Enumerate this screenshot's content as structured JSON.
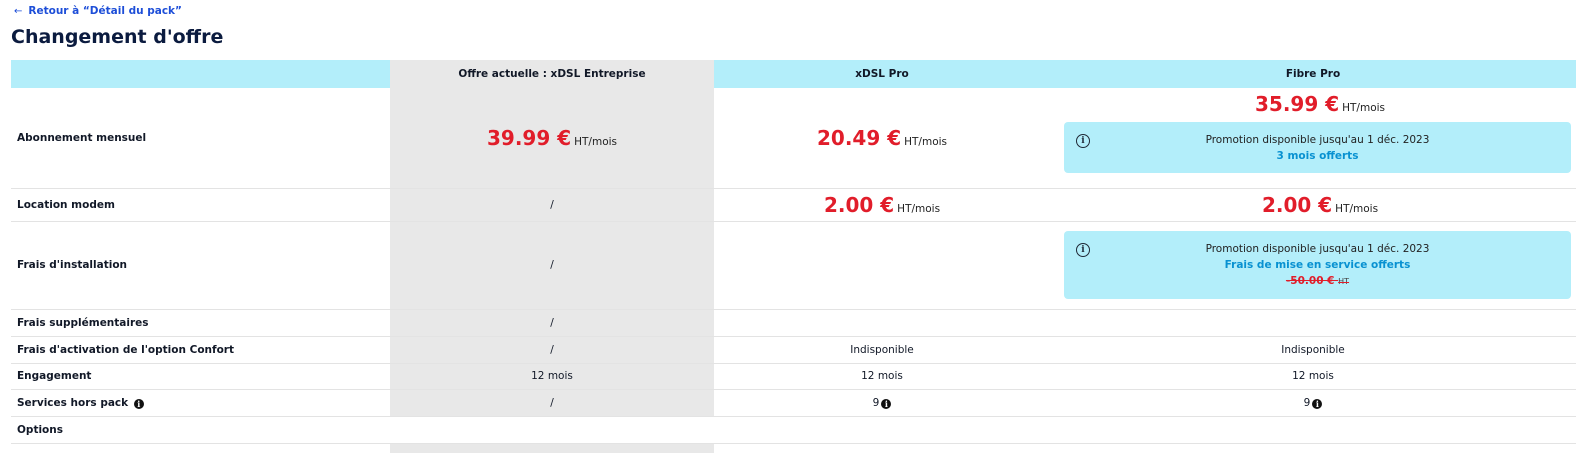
{
  "back_link": {
    "arrow": "←",
    "label": "Retour à “Détail du pack”"
  },
  "page_title": "Changement d'offre",
  "columns": {
    "current": "Offre actuelle : xDSL Entreprise",
    "xdsl": "xDSL Pro",
    "fibre": "Fibre Pro"
  },
  "rows": {
    "abonnement": {
      "label": "Abonnement mensuel",
      "current": {
        "amount": "39.99 €",
        "unit": "HT/mois"
      },
      "xdsl": {
        "amount": "20.49 €",
        "unit": "HT/mois"
      },
      "fibre": {
        "amount": "35.99 €",
        "unit": "HT/mois"
      },
      "fibre_promo": {
        "text": "Promotion disponible jusqu'au 1 déc. 2023",
        "offer": "3 mois offerts"
      }
    },
    "modem": {
      "label": "Location modem",
      "current": "/",
      "xdsl": {
        "amount": "2.00 €",
        "unit": "HT/mois"
      },
      "fibre": {
        "amount": "2.00 €",
        "unit": "HT/mois"
      }
    },
    "installation": {
      "label": "Frais d'installation",
      "current": "/",
      "fibre_promo": {
        "text": "Promotion disponible jusqu'au 1 déc. 2023",
        "offer": "Frais de mise en service offerts",
        "old_price": "-50.00 €",
        "old_unit": "HT"
      }
    },
    "supplementaires": {
      "label": "Frais supplémentaires",
      "current": "/"
    },
    "confort": {
      "label": "Frais d'activation de l'option Confort",
      "current": "/",
      "xdsl": "Indisponible",
      "fibre": "Indisponible"
    },
    "engagement": {
      "label": "Engagement",
      "current": "12 mois",
      "xdsl": "12 mois",
      "fibre": "12 mois"
    },
    "services": {
      "label": "Services hors pack",
      "current": "/",
      "xdsl": "9",
      "fibre": "9"
    },
    "options": {
      "label": "Options"
    }
  },
  "icons": {
    "info": "i"
  },
  "colors": {
    "accent_price": "#e11d2a",
    "header_bg": "#b3eefa",
    "current_col_bg": "#e8e8e8",
    "link": "#1d4ed8",
    "promo_link": "#0891d1"
  }
}
